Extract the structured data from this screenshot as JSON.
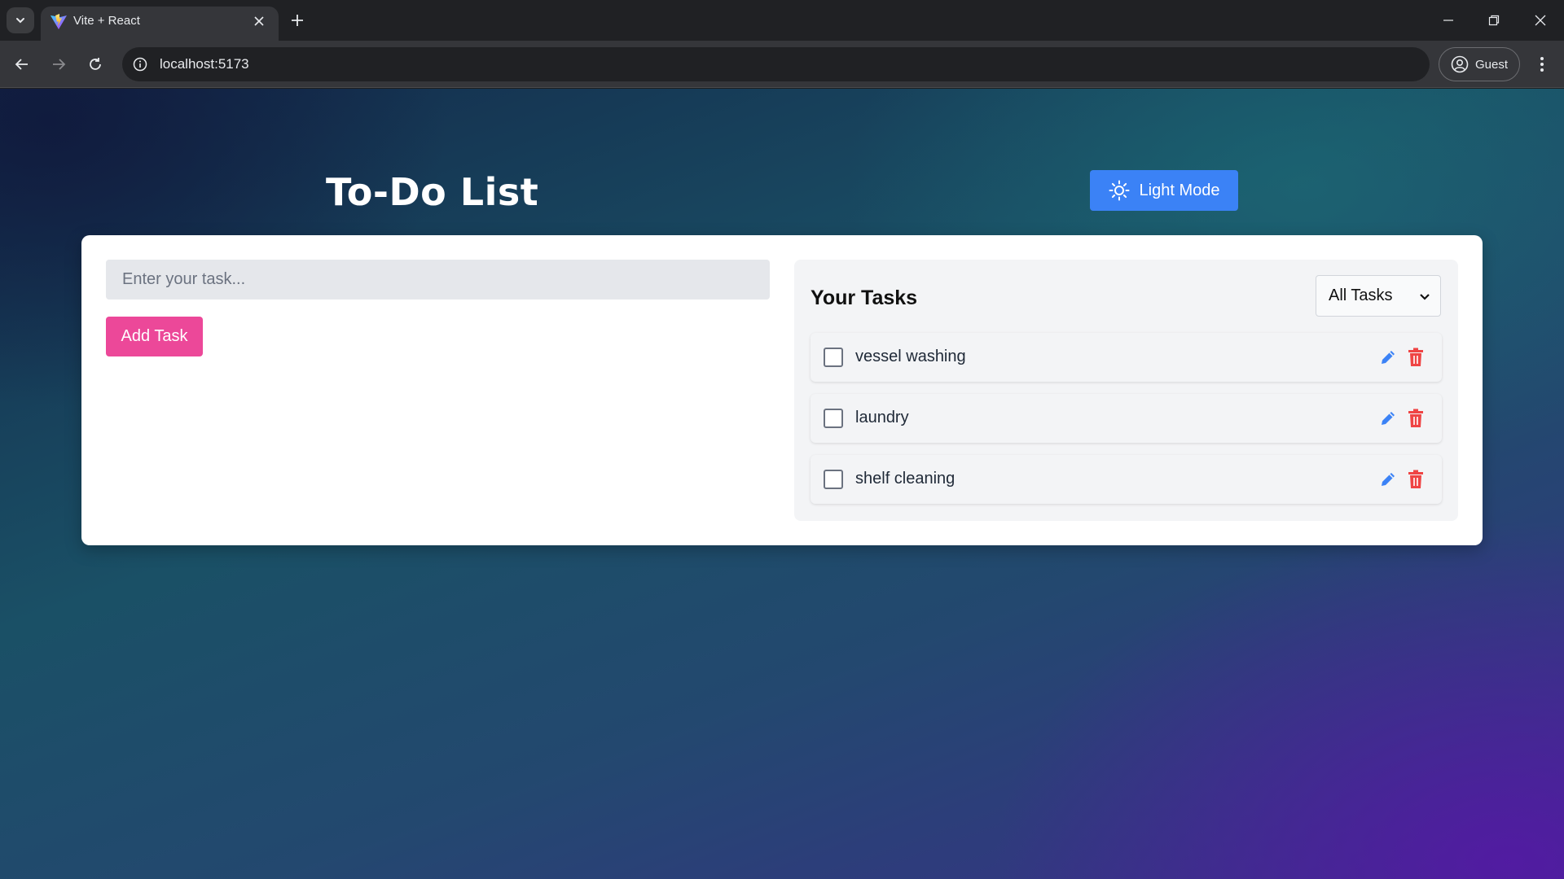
{
  "browser": {
    "tab_title": "Vite + React",
    "url": "localhost:5173",
    "profile_label": "Guest"
  },
  "app": {
    "title": "To-Do List",
    "theme_button_label": "Light Mode",
    "task_input_placeholder": "Enter your task...",
    "add_button_label": "Add Task",
    "tasks_heading": "Your Tasks",
    "filter_selected": "All Tasks",
    "tasks": [
      {
        "text": "vessel washing",
        "completed": false
      },
      {
        "text": "laundry",
        "completed": false
      },
      {
        "text": "shelf cleaning",
        "completed": false
      }
    ]
  },
  "icons": {
    "theme": "sun-icon",
    "edit": "pencil-icon",
    "delete": "trash-icon"
  },
  "colors": {
    "accent_blue": "#3b82f6",
    "accent_pink": "#ec4899",
    "delete_red": "#ef4444"
  }
}
